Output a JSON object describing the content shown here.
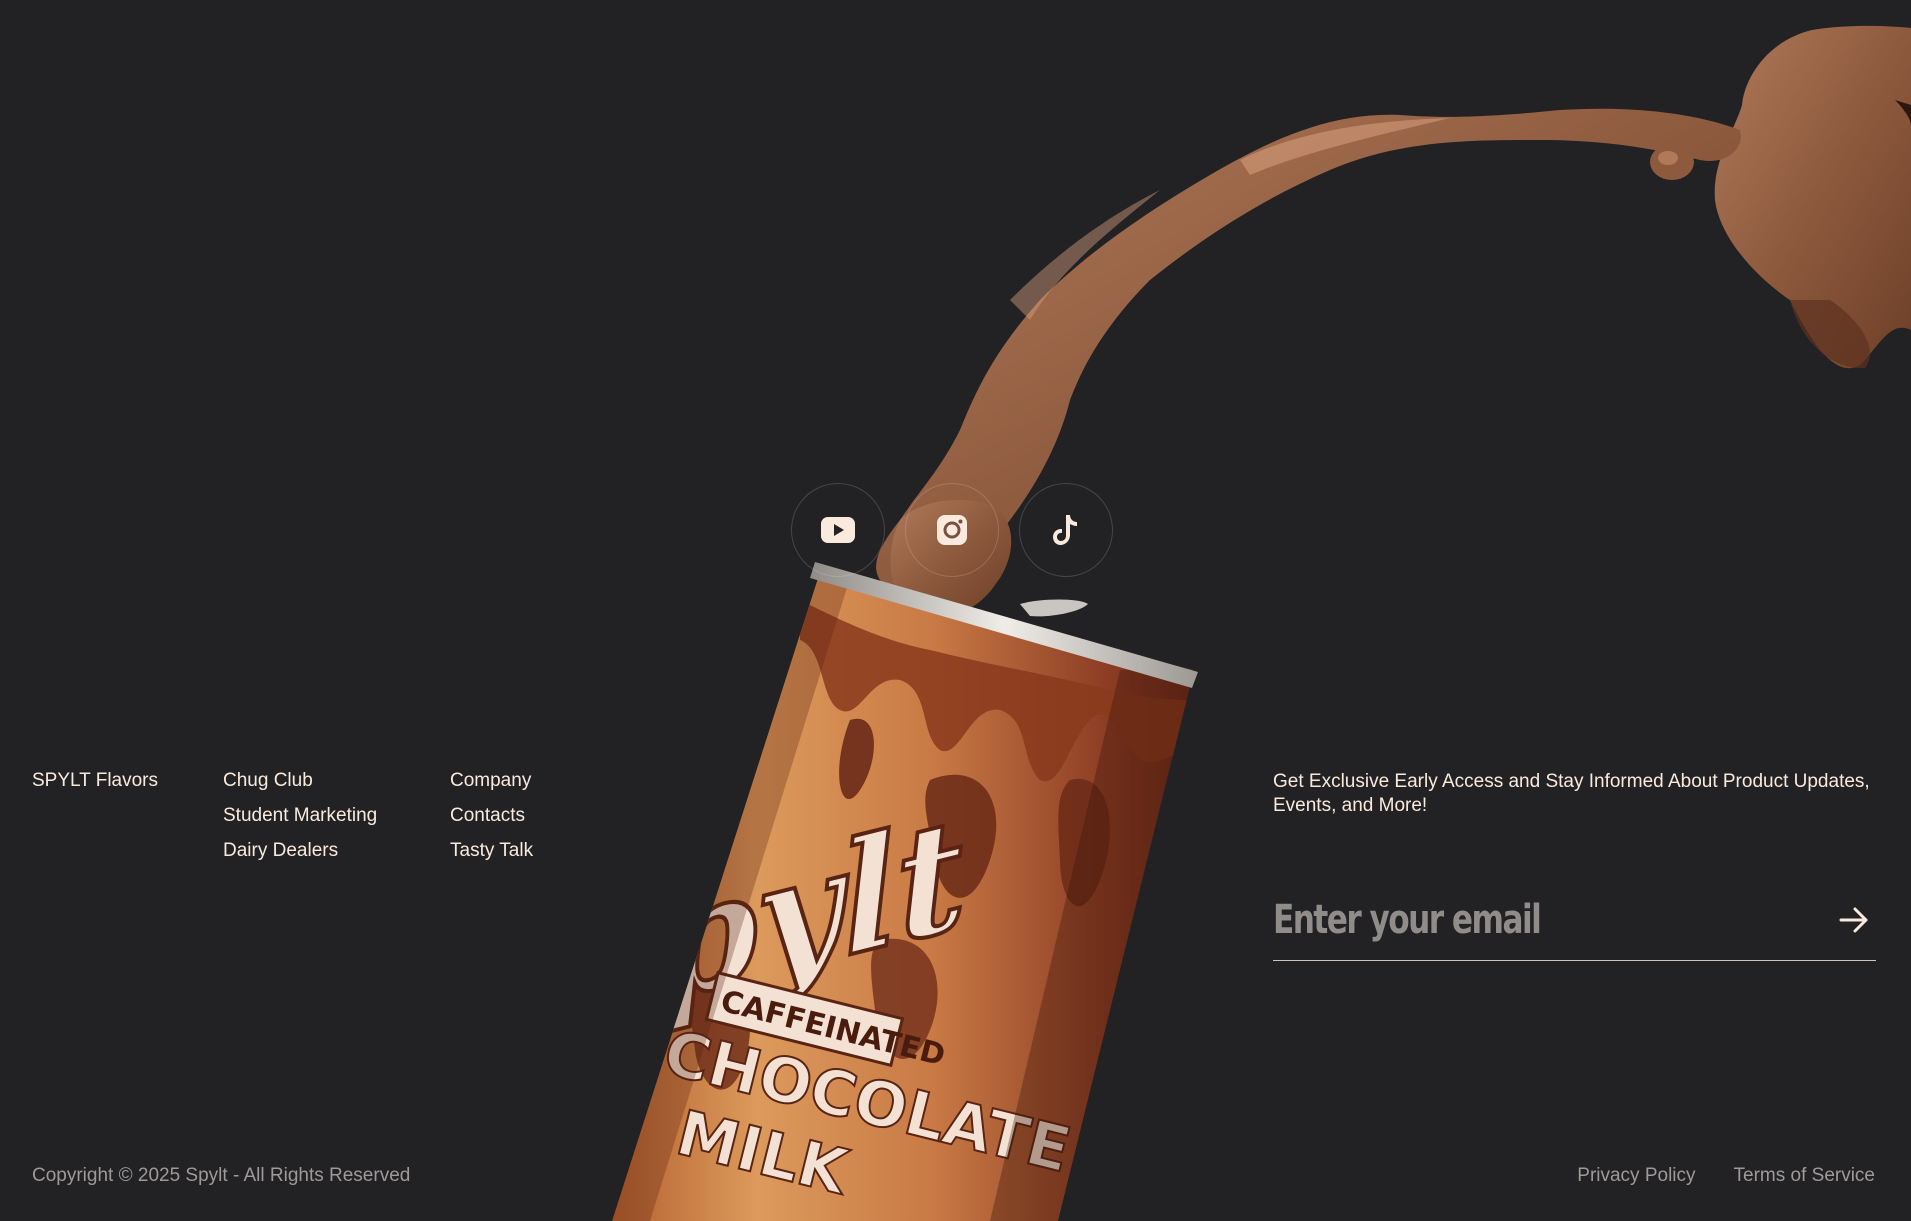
{
  "socials": {
    "youtube": "youtube-icon",
    "instagram": "instagram-icon",
    "tiktok": "tiktok-icon"
  },
  "can": {
    "brand": "Spylt",
    "tag": "CAFFEINATED",
    "flavor_line1": "CHOCOLATE",
    "flavor_line2": "MILK"
  },
  "nav": {
    "col1": [
      "SPYLT Flavors"
    ],
    "col2": [
      "Chug Club",
      "Student Marketing",
      "Dairy Dealers"
    ],
    "col3": [
      "Company",
      "Contacts",
      "Tasty Talk"
    ]
  },
  "newsletter": {
    "text": "Get Exclusive Early Access and Stay Informed About Product Updates, Events, and More!",
    "placeholder": "Enter your email",
    "submit_icon": "arrow-right-icon"
  },
  "footer": {
    "copyright": "Copyright © 2025 Spylt - All Rights Reserved",
    "privacy": "Privacy Policy",
    "terms": "Terms of Service"
  },
  "colors": {
    "background": "#222123",
    "text": "#faeade",
    "muted": "#9e9a97"
  }
}
